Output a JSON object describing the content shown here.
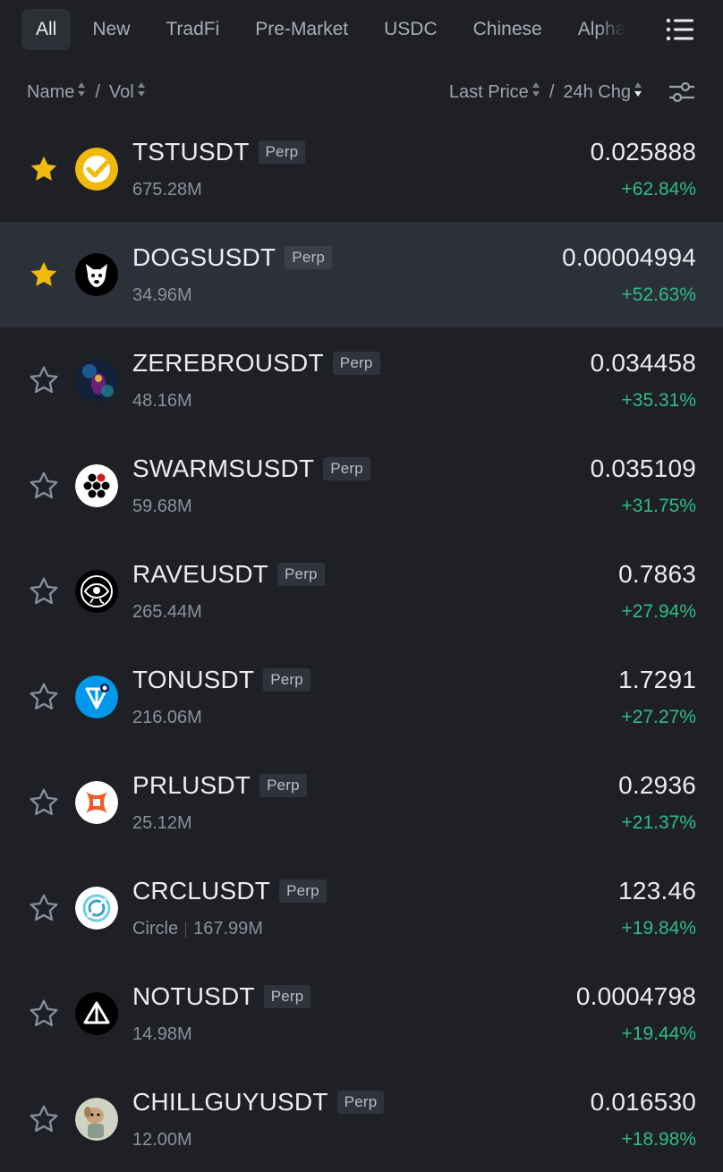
{
  "tabs": [
    {
      "label": "All",
      "active": true
    },
    {
      "label": "New"
    },
    {
      "label": "TradFi"
    },
    {
      "label": "Pre-Market"
    },
    {
      "label": "USDC"
    },
    {
      "label": "Chinese"
    },
    {
      "label": "Alpha"
    }
  ],
  "sort": {
    "name": "Name",
    "sep1": "/",
    "vol": "Vol",
    "last_price": "Last Price",
    "sep2": "/",
    "change": "24h Chg"
  },
  "colors": {
    "background": "#1e2026",
    "highlight_row": "#2b3039",
    "positive": "#2ebd85",
    "star_active": "#f0b90b",
    "star_inactive": "#848e9c"
  },
  "rows": [
    {
      "symbol": "TSTUSDT",
      "badge": "Perp",
      "volume": "675.28M",
      "price": "0.025888",
      "change": "+62.84%",
      "favorite": true,
      "icon": "tst-check-icon"
    },
    {
      "symbol": "DOGSUSDT",
      "badge": "Perp",
      "volume": "34.96M",
      "price": "0.00004994",
      "change": "+52.63%",
      "favorite": true,
      "icon": "dogs-icon"
    },
    {
      "symbol": "ZEREBROUSDT",
      "badge": "Perp",
      "volume": "48.16M",
      "price": "0.034458",
      "change": "+35.31%",
      "favorite": false,
      "icon": "zerebro-icon"
    },
    {
      "symbol": "SWARMSUSDT",
      "badge": "Perp",
      "volume": "59.68M",
      "price": "0.035109",
      "change": "+31.75%",
      "favorite": false,
      "icon": "swarms-icon"
    },
    {
      "symbol": "RAVEUSDT",
      "badge": "Perp",
      "volume": "265.44M",
      "price": "0.7863",
      "change": "+27.94%",
      "favorite": false,
      "icon": "rave-eye-icon"
    },
    {
      "symbol": "TONUSDT",
      "badge": "Perp",
      "volume": "216.06M",
      "price": "1.7291",
      "change": "+27.27%",
      "favorite": false,
      "icon": "ton-icon"
    },
    {
      "symbol": "PRLUSDT",
      "badge": "Perp",
      "volume": "25.12M",
      "price": "0.2936",
      "change": "+21.37%",
      "favorite": false,
      "icon": "prl-icon"
    },
    {
      "symbol": "CRCLUSDT",
      "badge": "Perp",
      "tag": "Circle",
      "volume": "167.99M",
      "price": "123.46",
      "change": "+19.84%",
      "favorite": false,
      "icon": "circle-icon"
    },
    {
      "symbol": "NOTUSDT",
      "badge": "Perp",
      "volume": "14.98M",
      "price": "0.0004798",
      "change": "+19.44%",
      "favorite": false,
      "icon": "notcoin-icon"
    },
    {
      "symbol": "CHILLGUYUSDT",
      "badge": "Perp",
      "volume": "12.00M",
      "price": "0.016530",
      "change": "+18.98%",
      "favorite": false,
      "icon": "chillguy-icon"
    }
  ]
}
